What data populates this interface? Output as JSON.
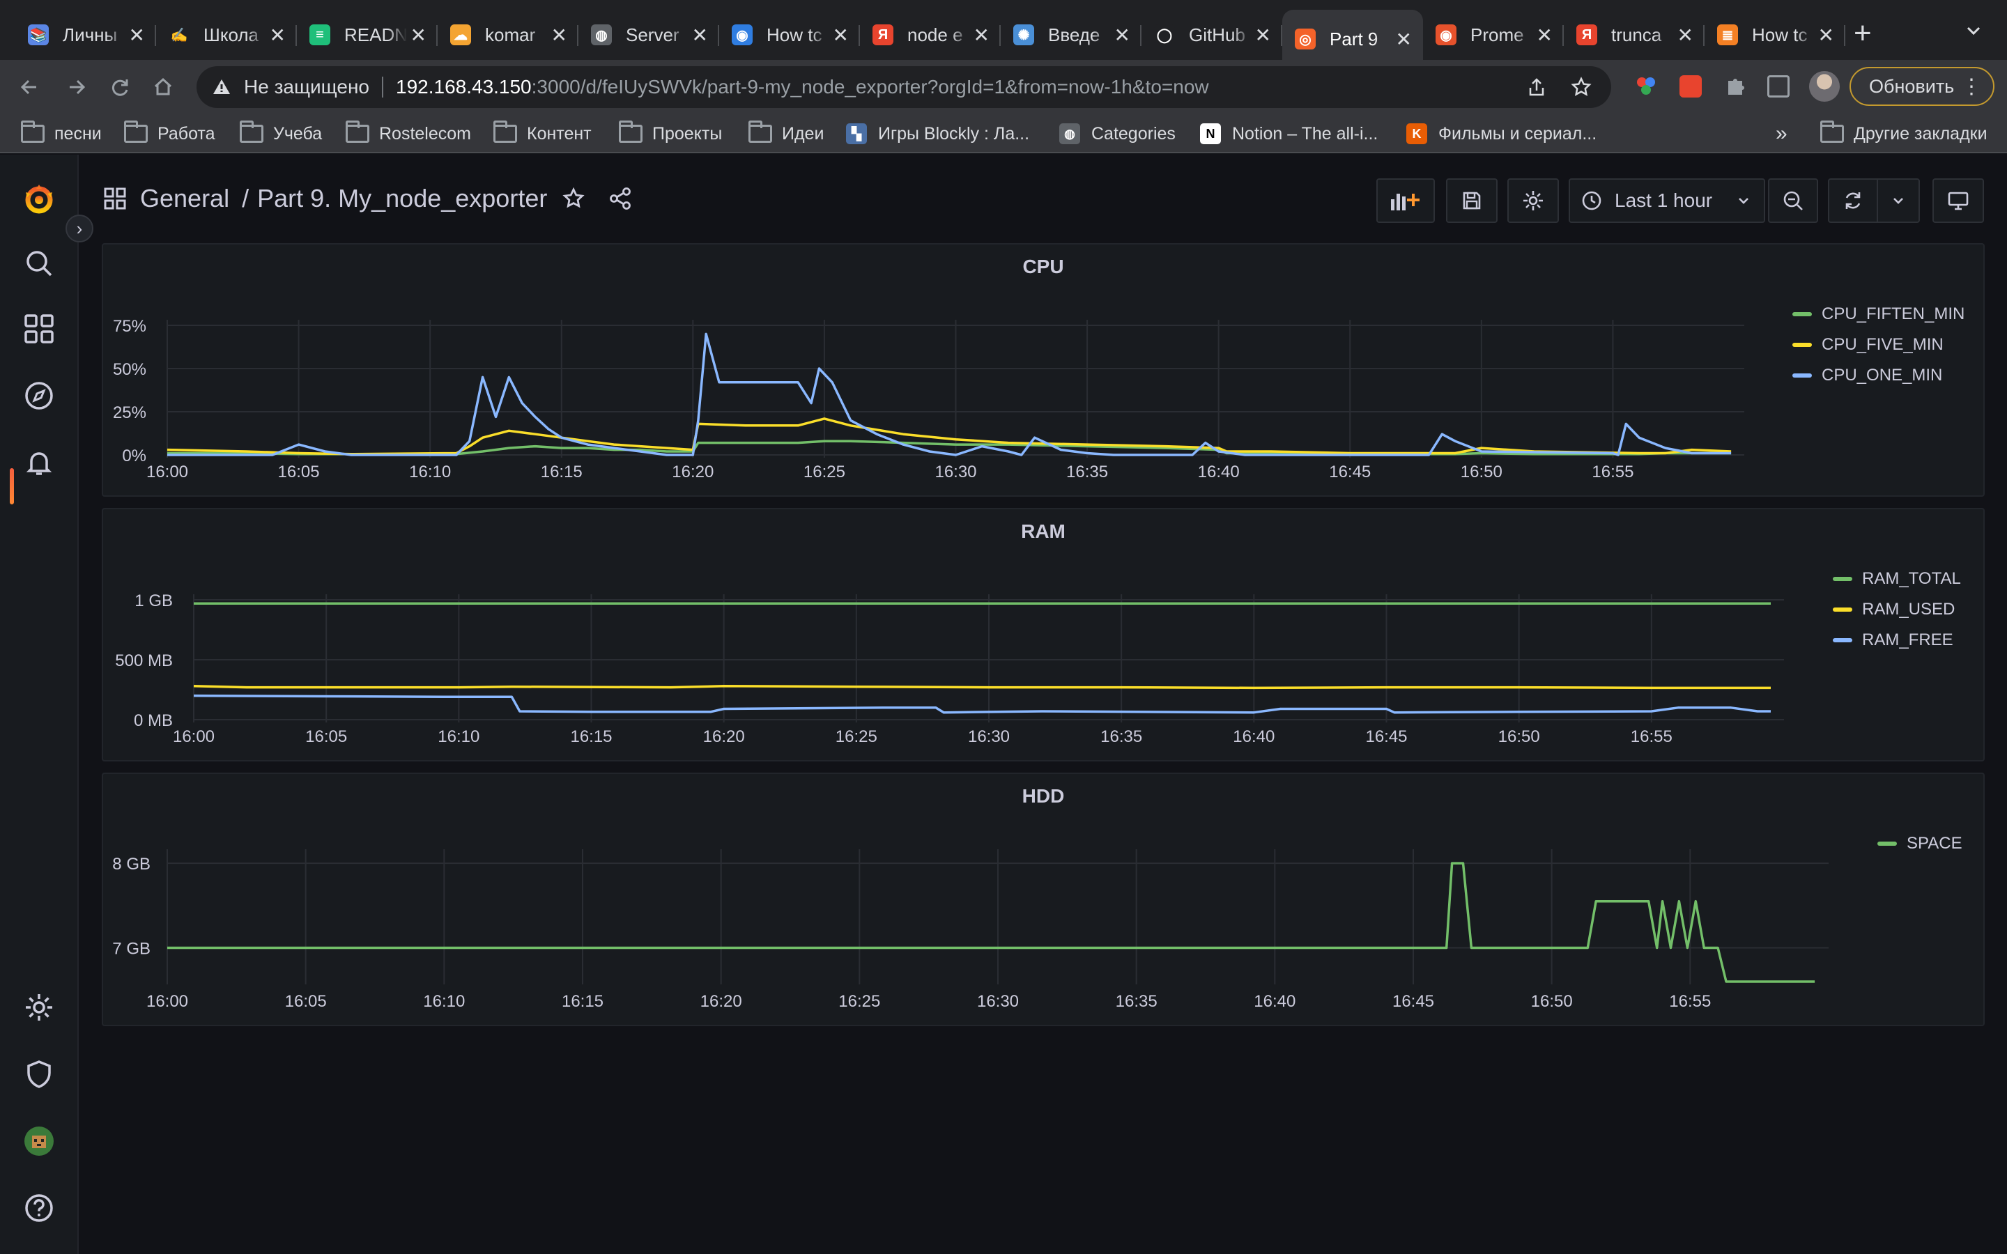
{
  "browser": {
    "tabs": [
      {
        "label": "Личны",
        "color": "#5b86e5",
        "glyph": "📚"
      },
      {
        "label": "Школа",
        "color": "#202124",
        "glyph": "✍"
      },
      {
        "label": "READN",
        "color": "#1fbf7a",
        "glyph": "≡"
      },
      {
        "label": "komar",
        "color": "#f4a432",
        "glyph": "☁"
      },
      {
        "label": "Server",
        "color": "#5f6368",
        "glyph": "◍"
      },
      {
        "label": "How tc",
        "color": "#2f7de1",
        "glyph": "◉"
      },
      {
        "label": "node e",
        "color": "#e8442e",
        "glyph": "Я"
      },
      {
        "label": "Введе",
        "color": "#4a8fd6",
        "glyph": "✺"
      },
      {
        "label": "GitHub",
        "color": "#202124",
        "glyph": "◯"
      },
      {
        "label": "Part 9",
        "color": "#f4632a",
        "glyph": "◎",
        "active": true
      },
      {
        "label": "Prome",
        "color": "#e6522c",
        "glyph": "◉"
      },
      {
        "label": "trunca",
        "color": "#e8442e",
        "glyph": "Я"
      },
      {
        "label": "How tc",
        "color": "#f48024",
        "glyph": "≣"
      }
    ],
    "new_tab": "+",
    "security_label": "Не защищено",
    "url_host": "192.168.43.150",
    "url_rest": ":3000/d/feIUySWVk/part-9-my_node_exporter?orgId=1&from=now-1h&to=now",
    "update_button": "Обновить",
    "bookmarks": [
      {
        "label": "песни",
        "type": "folder"
      },
      {
        "label": "Работа",
        "type": "folder"
      },
      {
        "label": "Учеба",
        "type": "folder"
      },
      {
        "label": "Rostelecom",
        "type": "folder"
      },
      {
        "label": "Контент",
        "type": "folder"
      },
      {
        "label": "Проекты",
        "type": "folder"
      },
      {
        "label": "Идеи",
        "type": "folder"
      },
      {
        "label": "Игры Blockly : Ла...",
        "type": "site",
        "color": "#4a6fa5",
        "glyph": "▚"
      },
      {
        "label": "Categories",
        "type": "site",
        "color": "#5f6368",
        "glyph": "◍"
      },
      {
        "label": "Notion – The all-i...",
        "type": "site",
        "color": "#ffffff",
        "glyph": "N"
      },
      {
        "label": "Фильмы и сериал...",
        "type": "site",
        "color": "#e85d04",
        "glyph": "K"
      }
    ],
    "bookmarks_more": "»",
    "other_bookmarks": "Другие закладки"
  },
  "grafana": {
    "breadcrumb_folder": "General",
    "breadcrumb_sep": "/",
    "dashboard_title": "Part 9. My_node_exporter",
    "time_range": "Last 1 hour"
  },
  "chart_data": [
    {
      "type": "line",
      "title": "CPU",
      "x_ticks": [
        "16:00",
        "16:05",
        "16:10",
        "16:15",
        "16:20",
        "16:25",
        "16:30",
        "16:35",
        "16:40",
        "16:45",
        "16:50",
        "16:55"
      ],
      "y_ticks": [
        "0%",
        "25%",
        "50%",
        "75%"
      ],
      "ylim": [
        0,
        75
      ],
      "x_range_min": [
        0,
        60
      ],
      "series": [
        {
          "name": "CPU_FIFTEN_MIN",
          "color": "#73bf69",
          "x": [
            0,
            3,
            5,
            7,
            11,
            12,
            13,
            14,
            15,
            16,
            17,
            18,
            19,
            20,
            20.2,
            22,
            24,
            25,
            26,
            28,
            30,
            32,
            35,
            38,
            40,
            40.3,
            42,
            45,
            48,
            49,
            50,
            52,
            56,
            57,
            58,
            59.5
          ],
          "y": [
            1,
            1,
            0.5,
            0.5,
            0.5,
            2,
            4,
            5,
            4,
            4,
            3,
            3,
            2,
            2,
            7,
            7,
            7,
            8,
            8,
            7,
            6,
            6,
            5,
            4,
            3,
            1,
            1,
            0.5,
            0.5,
            0.5,
            1,
            0.5,
            0.5,
            1,
            1,
            1
          ]
        },
        {
          "name": "CPU_FIVE_MIN",
          "color": "#fade2a",
          "x": [
            0,
            3,
            5,
            7,
            11,
            11.5,
            12,
            13,
            14,
            15,
            16,
            17,
            18,
            19,
            20,
            20.2,
            22,
            24,
            25,
            26,
            28,
            30,
            32,
            35,
            38,
            40,
            40.3,
            42,
            45,
            48,
            49,
            50,
            52,
            56,
            57,
            58,
            59.5
          ],
          "y": [
            3,
            2,
            1,
            0.5,
            1,
            5,
            10,
            14,
            12,
            10,
            8,
            6,
            5,
            4,
            3,
            18,
            17,
            17,
            21,
            17,
            12,
            9,
            7,
            6,
            5,
            4,
            2,
            2,
            1,
            1,
            1,
            4,
            2,
            1,
            1,
            3,
            2
          ]
        },
        {
          "name": "CPU_ONE_MIN",
          "color": "#8ab8ff",
          "x": [
            0,
            4,
            5,
            6,
            7,
            8,
            11,
            11.5,
            12,
            12.5,
            13,
            13.5,
            14,
            14.5,
            15,
            15.5,
            16,
            17,
            18,
            19,
            19.5,
            20,
            20.2,
            20.5,
            21,
            22,
            23,
            24,
            24.5,
            24.8,
            25.3,
            26,
            27,
            28,
            29,
            30,
            31,
            32,
            32.5,
            33,
            34,
            35,
            36,
            37.5,
            39,
            39.5,
            40,
            41,
            45,
            47,
            48,
            48.5,
            49,
            50,
            55,
            55.2,
            55.5,
            56,
            57,
            58,
            59.5
          ],
          "y": [
            0,
            0,
            6,
            2,
            0,
            0,
            0,
            8,
            45,
            22,
            45,
            30,
            22,
            15,
            10,
            8,
            6,
            4,
            2,
            0,
            0,
            0,
            20,
            70,
            42,
            42,
            42,
            42,
            30,
            50,
            42,
            20,
            12,
            6,
            2,
            0,
            5,
            2,
            0,
            10,
            3,
            1,
            0,
            0,
            0,
            7,
            2,
            0,
            0,
            0,
            0,
            12,
            8,
            2,
            1,
            0,
            18,
            10,
            4,
            1,
            1
          ]
        }
      ]
    },
    {
      "type": "line",
      "title": "RAM",
      "x_ticks": [
        "16:00",
        "16:05",
        "16:10",
        "16:15",
        "16:20",
        "16:25",
        "16:30",
        "16:35",
        "16:40",
        "16:45",
        "16:50",
        "16:55"
      ],
      "y_ticks": [
        "0 MB",
        "500 MB",
        "1 GB"
      ],
      "ylim": [
        0,
        1000
      ],
      "x_range_min": [
        0,
        60
      ],
      "series": [
        {
          "name": "RAM_TOTAL",
          "color": "#73bf69",
          "x": [
            0,
            59.5
          ],
          "y": [
            970,
            970
          ]
        },
        {
          "name": "RAM_USED",
          "color": "#fade2a",
          "x": [
            0,
            2,
            10,
            12,
            18,
            20,
            25,
            30,
            35,
            40,
            45,
            50,
            55,
            59.5
          ],
          "y": [
            280,
            270,
            270,
            275,
            270,
            280,
            275,
            270,
            270,
            265,
            270,
            270,
            265,
            265
          ]
        },
        {
          "name": "RAM_FREE",
          "color": "#8ab8ff",
          "x": [
            0,
            5,
            10,
            12,
            12.3,
            15,
            19.5,
            20,
            26,
            28,
            28.3,
            32,
            40,
            41,
            44,
            45,
            45.3,
            50,
            55,
            56,
            58,
            59,
            59.5
          ],
          "y": [
            200,
            195,
            190,
            190,
            70,
            65,
            65,
            90,
            100,
            100,
            60,
            70,
            60,
            90,
            90,
            90,
            60,
            65,
            70,
            100,
            100,
            70,
            70
          ]
        }
      ]
    },
    {
      "type": "line",
      "title": "HDD",
      "x_ticks": [
        "16:00",
        "16:05",
        "16:10",
        "16:15",
        "16:20",
        "16:25",
        "16:30",
        "16:35",
        "16:40",
        "16:45",
        "16:50",
        "16:55"
      ],
      "y_ticks": [
        "7 GB",
        "8 GB"
      ],
      "ylim": [
        6.6,
        8.1
      ],
      "x_range_min": [
        0,
        60
      ],
      "series": [
        {
          "name": "SPACE",
          "color": "#73bf69",
          "x": [
            0,
            39,
            46.2,
            46.4,
            46.8,
            47.1,
            51.3,
            51.6,
            53.5,
            53.8,
            54.0,
            54.3,
            54.6,
            54.9,
            55.2,
            55.5,
            56.0,
            56.3,
            59.5
          ],
          "y": [
            7,
            7,
            7,
            8,
            8,
            7,
            7,
            7.55,
            7.55,
            7,
            7.55,
            7,
            7.55,
            7,
            7.55,
            7,
            7,
            6.6,
            6.6
          ]
        }
      ]
    }
  ]
}
